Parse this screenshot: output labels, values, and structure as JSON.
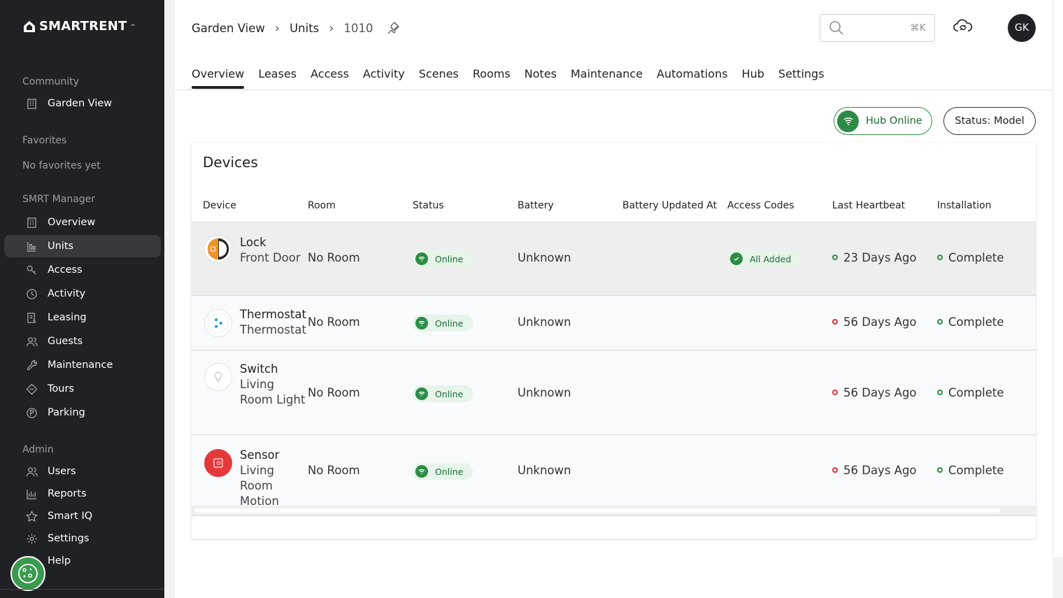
{
  "brand": {
    "logo_text": "SmartRent"
  },
  "sidebar": {
    "community_title": "Community",
    "community_item": "Garden View",
    "favorites_title": "Favorites",
    "favorites_empty": "No favorites yet",
    "manager_title": "SMRT Manager",
    "manager_items": [
      {
        "label": "Overview",
        "icon": "building-icon"
      },
      {
        "label": "Units",
        "icon": "units-icon"
      },
      {
        "label": "Access",
        "icon": "key-icon"
      },
      {
        "label": "Activity",
        "icon": "clock-icon"
      },
      {
        "label": "Leasing",
        "icon": "leasing-icon"
      },
      {
        "label": "Guests",
        "icon": "guests-icon"
      },
      {
        "label": "Maintenance",
        "icon": "wrench-icon"
      },
      {
        "label": "Tours",
        "icon": "tours-icon"
      },
      {
        "label": "Parking",
        "icon": "parking-icon"
      }
    ],
    "admin_title": "Admin",
    "admin_items": [
      {
        "label": "Users",
        "icon": "users-icon"
      },
      {
        "label": "Reports",
        "icon": "chart-icon"
      },
      {
        "label": "Smart IQ",
        "icon": "star-icon"
      },
      {
        "label": "Settings",
        "icon": "gear-icon"
      },
      {
        "label": "Help",
        "icon": "help-icon"
      }
    ]
  },
  "breadcrumb": {
    "community": "Garden View",
    "section": "Units",
    "unit": "1010"
  },
  "search": {
    "shortcut": "⌘K"
  },
  "user": {
    "initials": "GK"
  },
  "tabs": [
    "Overview",
    "Leases",
    "Access",
    "Activity",
    "Scenes",
    "Rooms",
    "Notes",
    "Maintenance",
    "Automations",
    "Hub",
    "Settings"
  ],
  "hub_status": "Hub Online",
  "unit_status": "Status: Model",
  "devices": {
    "title": "Devices",
    "columns": [
      "Device",
      "Room",
      "Status",
      "Battery",
      "Battery Updated At",
      "Access Codes",
      "Last Heartbeat",
      "Installation"
    ],
    "rows": [
      {
        "name": "Lock",
        "sub": "Front Door",
        "room": "No Room",
        "status": "Online",
        "battery": "Unknown",
        "battery_updated": "",
        "access_codes": "All Added",
        "heartbeat": "23 Days Ago",
        "heartbeat_ok": true,
        "installation": "Complete"
      },
      {
        "name": "Thermostat",
        "sub": "Thermostat",
        "room": "No Room",
        "status": "Online",
        "battery": "Unknown",
        "battery_updated": "",
        "access_codes": "",
        "heartbeat": "56 Days Ago",
        "heartbeat_ok": false,
        "installation": "Complete"
      },
      {
        "name": "Switch",
        "sub": "Living Room Light",
        "room": "No Room",
        "status": "Online",
        "battery": "Unknown",
        "battery_updated": "",
        "access_codes": "",
        "heartbeat": "56 Days Ago",
        "heartbeat_ok": false,
        "installation": "Complete"
      },
      {
        "name": "Sensor",
        "sub": "Living Room Motion",
        "room": "No Room",
        "status": "Online",
        "battery": "Unknown",
        "battery_updated": "",
        "access_codes": "",
        "heartbeat": "56 Days Ago",
        "heartbeat_ok": false,
        "installation": "Complete"
      }
    ]
  },
  "colors": {
    "sidebar_bg": "#1f2124",
    "online_green": "#2e8b46",
    "alert_red": "#d93636",
    "sensor_red": "#e5383b",
    "lock_orange": "#f0942a"
  }
}
